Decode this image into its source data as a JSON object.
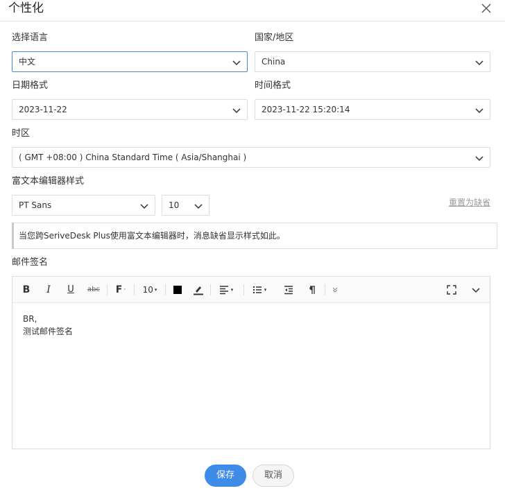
{
  "dialog": {
    "title": "个性化"
  },
  "language": {
    "label": "选择语言",
    "value": "中文"
  },
  "country": {
    "label": "国家/地区",
    "value": "China"
  },
  "date_format": {
    "label": "日期格式",
    "value": "2023-11-22"
  },
  "time_format": {
    "label": "时间格式",
    "value": "2023-11-22 15:20:14"
  },
  "timezone": {
    "label": "时区",
    "value": "( GMT +08:00 ) China Standard Time ( Asia/Shanghai )"
  },
  "rich_text_style": {
    "label": "富文本编辑器样式",
    "font_value": "PT Sans",
    "size_value": "10",
    "reset_label": "重置为缺省"
  },
  "note": {
    "text": "当您跨SeriveDesk Plus使用富文本编辑器时，消息缺省显示样式如此。"
  },
  "signature": {
    "label": "邮件签名",
    "toolbar": {
      "bold": "B",
      "italic": "I",
      "underline": "U",
      "strikethrough": "abc",
      "font_family": "F",
      "font_size": "10"
    },
    "lines": [
      "BR,",
      "测试邮件签名"
    ]
  },
  "buttons": {
    "save": "保存",
    "cancel": "取消"
  },
  "colors": {
    "accent": "#3f8be8",
    "focus_border": "#4a86d6"
  }
}
